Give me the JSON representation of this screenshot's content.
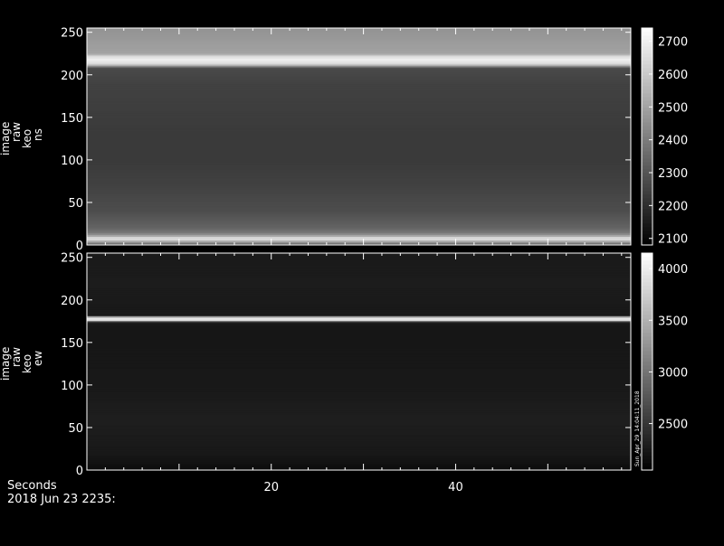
{
  "chart_data": [
    {
      "type": "heatmap",
      "panel": "top",
      "ylabel_lines": [
        "image",
        "raw",
        "keo",
        "ns"
      ],
      "xlim": [
        0,
        59
      ],
      "ylim": [
        0,
        255
      ],
      "yticks": [
        0,
        50,
        100,
        150,
        200,
        250
      ],
      "xticks": [
        20,
        40
      ],
      "colorbar": {
        "range": [
          2080,
          2740
        ],
        "ticks": [
          2100,
          2200,
          2300,
          2400,
          2500,
          2600,
          2700
        ]
      },
      "row_profile": [
        [
          0,
          2250
        ],
        [
          3,
          2450
        ],
        [
          6,
          2600
        ],
        [
          8,
          2700
        ],
        [
          10,
          2550
        ],
        [
          14,
          2400
        ],
        [
          20,
          2340
        ],
        [
          40,
          2280
        ],
        [
          70,
          2250
        ],
        [
          100,
          2230
        ],
        [
          130,
          2230
        ],
        [
          160,
          2240
        ],
        [
          190,
          2250
        ],
        [
          208,
          2270
        ],
        [
          210,
          2420
        ],
        [
          213,
          2650
        ],
        [
          218,
          2700
        ],
        [
          222,
          2650
        ],
        [
          225,
          2500
        ],
        [
          240,
          2480
        ],
        [
          255,
          2460
        ]
      ]
    },
    {
      "type": "heatmap",
      "panel": "bottom",
      "ylabel_lines": [
        "image",
        "raw",
        "keo",
        "ew"
      ],
      "xlim": [
        0,
        59
      ],
      "ylim": [
        0,
        255
      ],
      "yticks": [
        0,
        50,
        100,
        150,
        200,
        250
      ],
      "xticks": [
        20,
        40
      ],
      "colorbar": {
        "range": [
          2050,
          4150
        ],
        "ticks": [
          2500,
          3000,
          3500,
          4000
        ],
        "side_label": "Sun_Apr_29_14:04:11_2018"
      },
      "row_profile": [
        [
          0,
          2150
        ],
        [
          20,
          2250
        ],
        [
          60,
          2300
        ],
        [
          100,
          2250
        ],
        [
          160,
          2230
        ],
        [
          174,
          2240
        ],
        [
          176,
          3800
        ],
        [
          178,
          4050
        ],
        [
          180,
          3600
        ],
        [
          182,
          2250
        ],
        [
          220,
          2280
        ],
        [
          255,
          2260
        ]
      ]
    }
  ],
  "footer": {
    "xlabel": "Seconds",
    "date": "2018 Jun 23 2235:"
  }
}
